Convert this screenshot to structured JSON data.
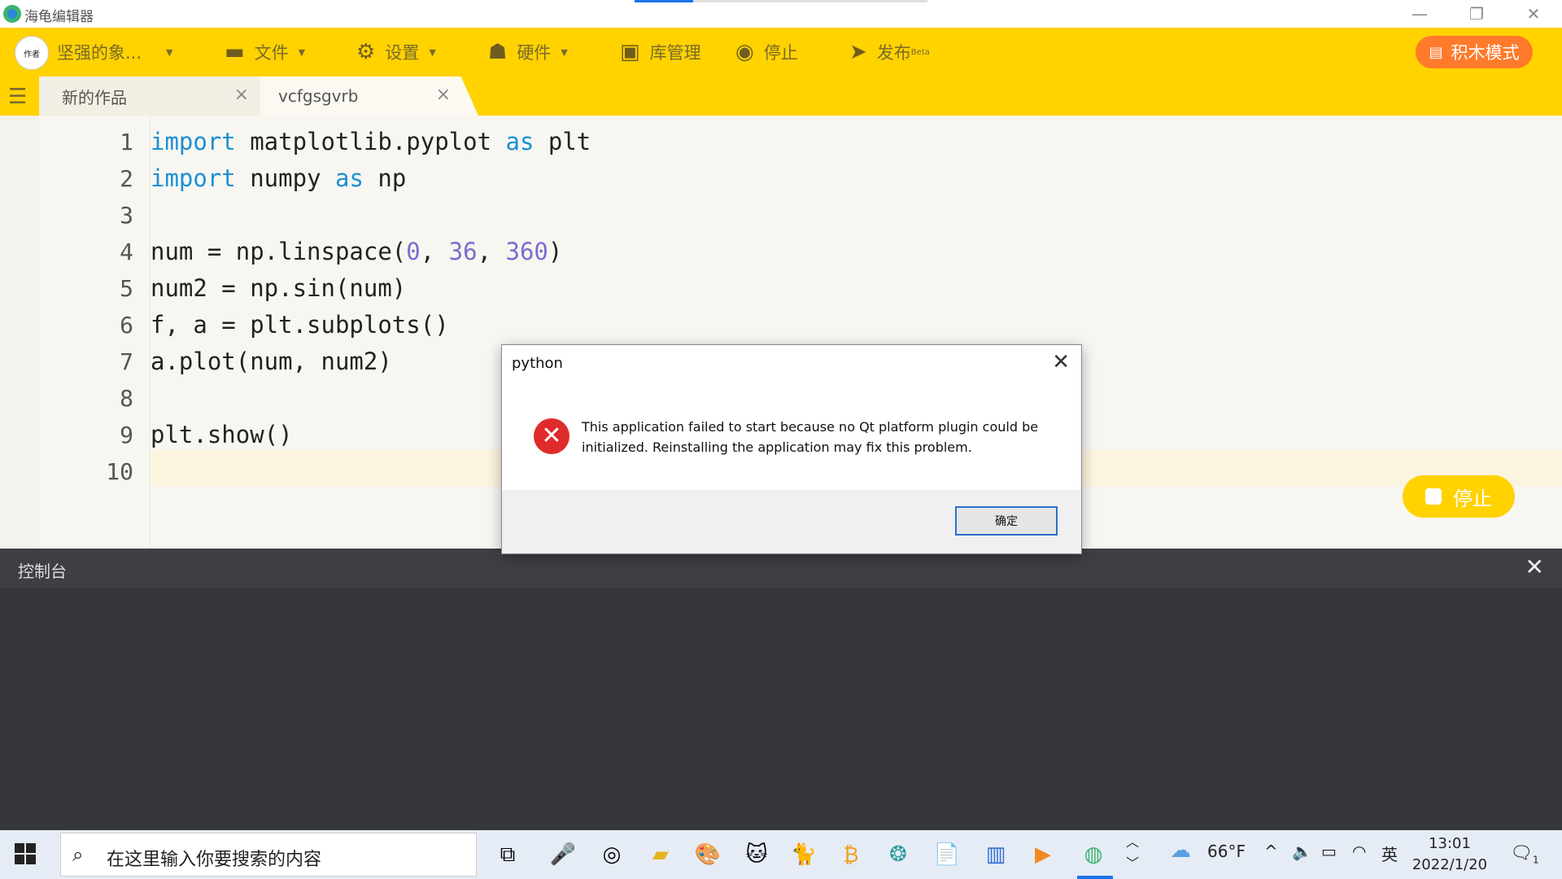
{
  "window": {
    "title": "海龟编辑器",
    "minimize": "—",
    "restore": "❐",
    "close": "✕"
  },
  "toolbar": {
    "user_name": "坚强的象...",
    "avatar_text": "作者",
    "file": "文件",
    "settings": "设置",
    "hardware": "硬件",
    "library": "库管理",
    "stop": "停止",
    "publish": "发布",
    "publish_badge": "Beta",
    "block_mode": "积木模式"
  },
  "tabs": [
    {
      "label": "新的作品",
      "close": "×"
    },
    {
      "label": "vcfgsgvrb",
      "close": "×"
    }
  ],
  "editor": {
    "line_numbers": [
      "1",
      "2",
      "3",
      "4",
      "5",
      "6",
      "7",
      "8",
      "9",
      "10"
    ],
    "lines": {
      "l1_kw1": "import",
      "l1_mid": " matplotlib.pyplot ",
      "l1_kw2": "as",
      "l1_end": " plt",
      "l2_kw1": "import",
      "l2_mid": " numpy ",
      "l2_kw2": "as",
      "l2_end": " np",
      "l4_a": "num = np.linspace(",
      "l4_n1": "0",
      "l4_c1": ", ",
      "l4_n2": "36",
      "l4_c2": ", ",
      "l4_n3": "360",
      "l4_end": ")",
      "l5": "num2 = np.sin(num)",
      "l6": "f, a = plt.subplots()",
      "l7": "a.plot(num, num2)",
      "l9": "plt.show()"
    },
    "stop_button": "停止"
  },
  "console": {
    "title": "控制台",
    "close": "✕"
  },
  "dialog": {
    "title": "python",
    "close": "✕",
    "icon": "✕",
    "message": "This application failed to start because no Qt platform plugin could be initialized. Reinstalling the application may fix this problem.",
    "ok_button": "确定"
  },
  "taskbar": {
    "search_placeholder": "在这里输入你要搜索的内容",
    "weather": "66°F",
    "ime": "英",
    "time": "13:01",
    "date": "2022/1/20",
    "notification_count": "1"
  },
  "colors": {
    "toolbar_yellow": "#ffd200",
    "block_mode_orange": "#ff7a2a",
    "keyword_blue": "#1b8fd6",
    "number_purple": "#7d6bd0",
    "console_bg": "#35373b"
  }
}
